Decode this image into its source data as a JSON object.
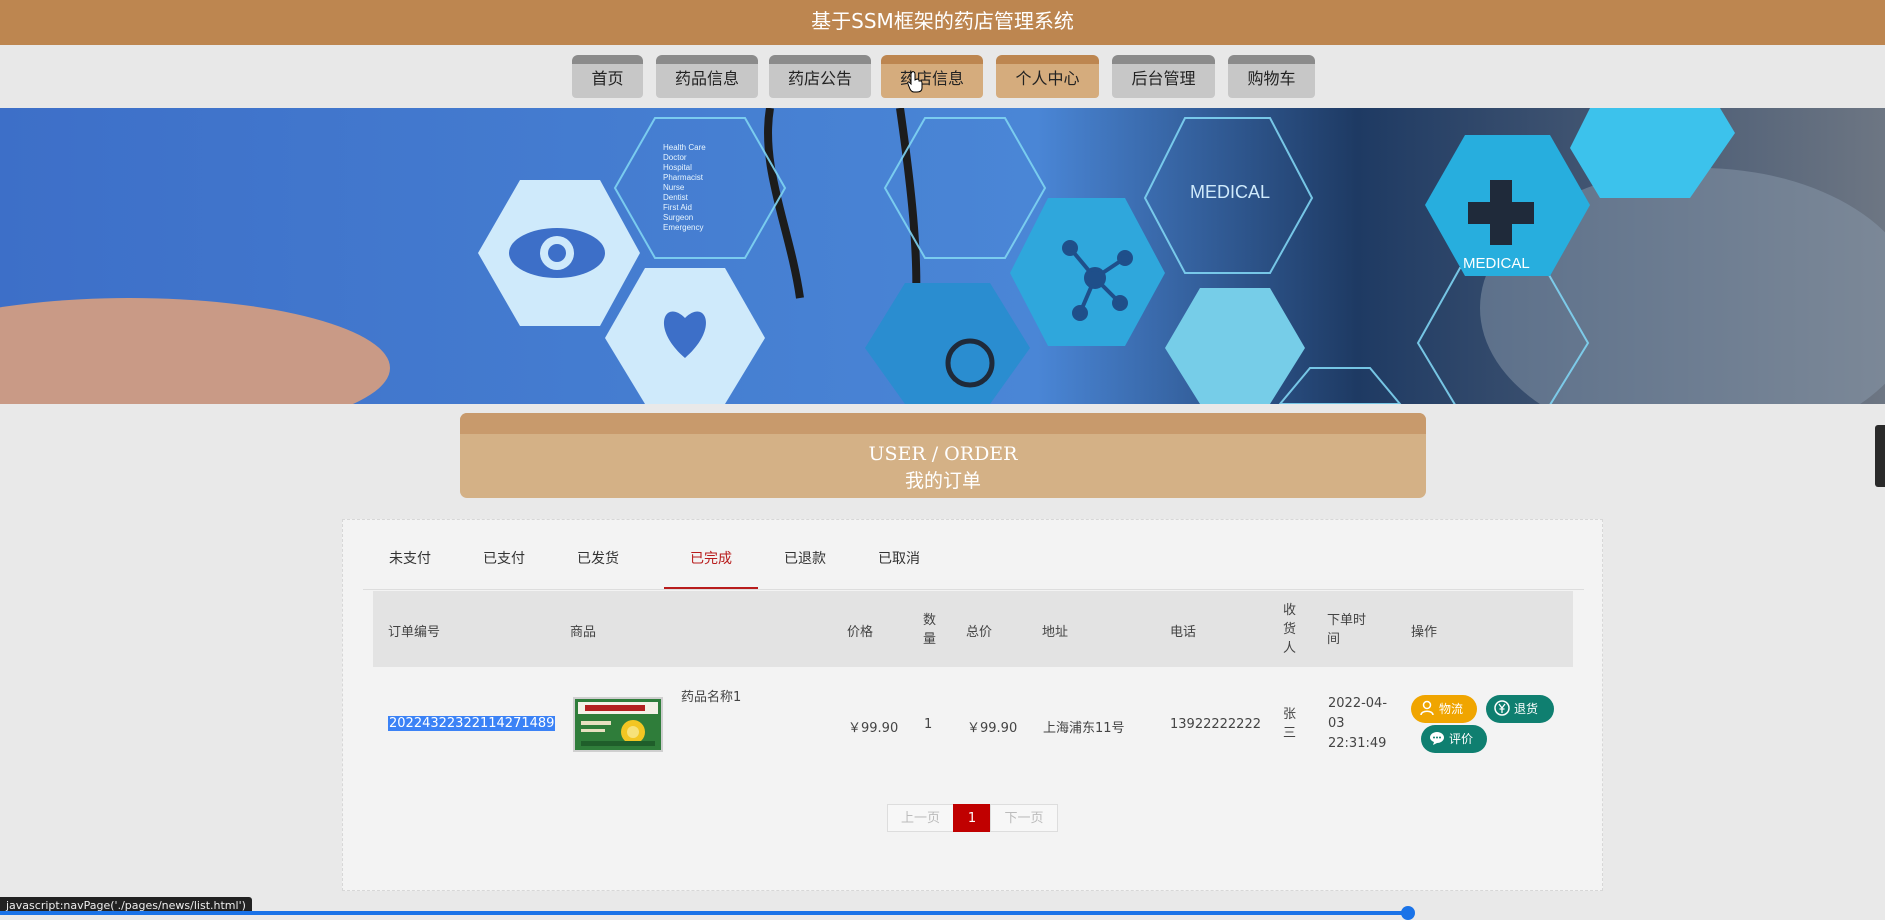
{
  "header": {
    "title": "基于SSM框架的药店管理系统"
  },
  "nav": {
    "items": [
      {
        "label": "首页",
        "active": false
      },
      {
        "label": "药品信息",
        "active": false
      },
      {
        "label": "药店公告",
        "active": false
      },
      {
        "label": "药店信息",
        "active": true
      },
      {
        "label": "个人中心",
        "active": true
      },
      {
        "label": "后台管理",
        "active": false
      },
      {
        "label": "购物车",
        "active": false
      }
    ]
  },
  "banner": {
    "hex_labels": [
      "MEDICAL",
      "MEDICAL"
    ],
    "list_text": [
      "Health Care",
      "Doctor",
      "Hospital",
      "Pharmacist",
      "Nurse",
      "Dentist",
      "First Aid",
      "Surgeon",
      "Emergency"
    ]
  },
  "section": {
    "title_en": "USER / ORDER",
    "title_cn": "我的订单"
  },
  "tabs": [
    {
      "label": "未支付",
      "active": false
    },
    {
      "label": "已支付",
      "active": false
    },
    {
      "label": "已发货",
      "active": false
    },
    {
      "label": "已完成",
      "active": true
    },
    {
      "label": "已退款",
      "active": false
    },
    {
      "label": "已取消",
      "active": false
    }
  ],
  "table": {
    "headers": {
      "order_no": "订单编号",
      "goods": "商品",
      "price": "价格",
      "qty": "数量",
      "total": "总价",
      "address": "地址",
      "phone": "电话",
      "receiver": "收货人",
      "order_time": "下单时间",
      "actions": "操作"
    },
    "rows": [
      {
        "order_no": "20224322322114271489",
        "goods_name": "药品名称1",
        "price": "￥99.90",
        "qty": "1",
        "total": "￥99.90",
        "address": "上海浦东11号",
        "phone": "13922222222",
        "receiver": "张三",
        "order_time": "2022-04-03 22:31:49",
        "actions": {
          "logistics": "物流",
          "refund": "退货",
          "review": "评价"
        }
      }
    ]
  },
  "pager": {
    "prev": "上一页",
    "current": "1",
    "next": "下一页"
  },
  "statusbar": {
    "link": "javascript:navPage('./pages/news/list.html')"
  },
  "colors": {
    "brand": "#bd8650",
    "brand_light": "#d5ac7d",
    "active_tab": "#b81c1c",
    "btn_orange": "#f0a500",
    "btn_teal": "#0f7f70",
    "page_current": "#c00000"
  }
}
